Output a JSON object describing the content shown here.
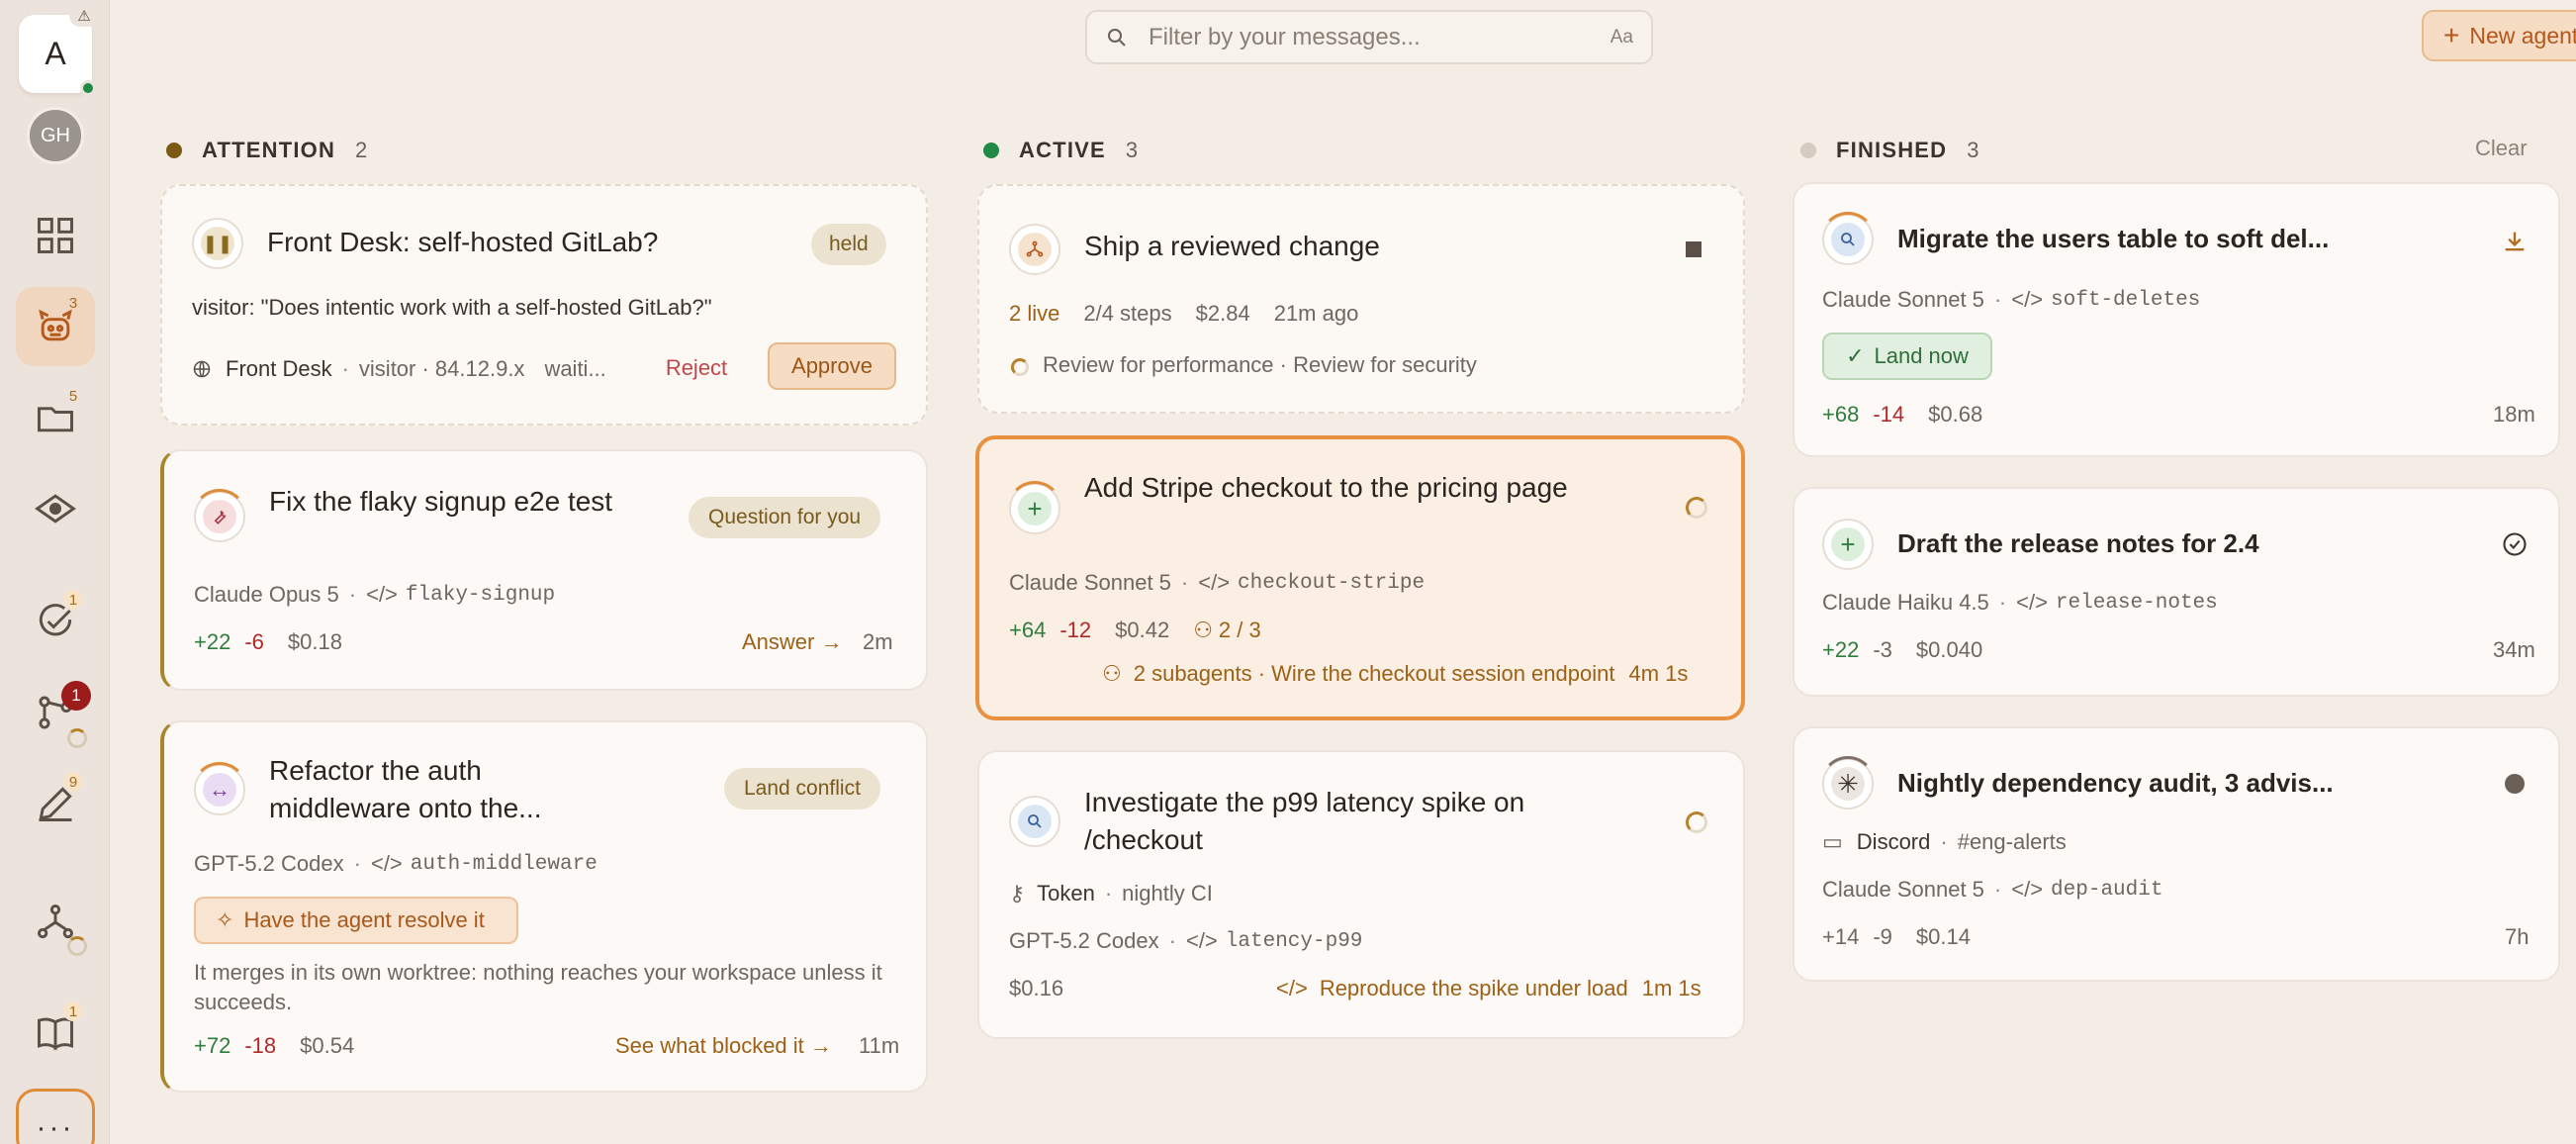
{
  "sidebar": {
    "logo_letter": "A",
    "warning_glyph": "⚠",
    "avatar_initials": "GH",
    "badges": {
      "agents": "3",
      "folder": "5",
      "tasks": "1",
      "git": "1",
      "edit": "9",
      "docs": "1"
    },
    "more_label": "···"
  },
  "search": {
    "placeholder": "Filter by your messages...",
    "case_toggle": "Aa"
  },
  "new_agent": {
    "plus": "+",
    "label": "New agent"
  },
  "columns": {
    "attention": {
      "title": "ATTENTION",
      "count": "2",
      "dot_color": "#7b5a14"
    },
    "active": {
      "title": "ACTIVE",
      "count": "3",
      "dot_color": "#1f8a45"
    },
    "finished": {
      "title": "FINISHED",
      "count": "3",
      "dot_color": "#d6cbc0",
      "clear": "Clear"
    }
  },
  "cards": {
    "front_desk": {
      "title": "Front Desk: self-hosted GitLab?",
      "badge": "held",
      "quote": "visitor: \"Does intentic work with a self-hosted GitLab?\"",
      "source": "Front Desk",
      "visitor": "visitor · 84.12.9.x",
      "waiting": "waiti...",
      "reject": "Reject",
      "approve": "Approve"
    },
    "flaky": {
      "title": "Fix the flaky signup e2e test",
      "badge": "Question for you",
      "model": "Claude Opus 5",
      "branch": "flaky-signup",
      "add": "+22",
      "del": "-6",
      "cost": "$0.18",
      "action": "Answer →",
      "time": "2m"
    },
    "refactor": {
      "title": "Refactor the auth middleware onto the...",
      "badge": "Land conflict",
      "model": "GPT-5.2 Codex",
      "branch": "auth-middleware",
      "resolve": "Have the agent resolve it",
      "note": "It merges in its own worktree: nothing reaches your workspace unless it succeeds.",
      "add": "+72",
      "del": "-18",
      "cost": "$0.54",
      "action": "See what blocked it →",
      "time": "11m"
    },
    "ship": {
      "title": "Ship a reviewed change",
      "live": "2 live",
      "steps": "2/4 steps",
      "cost": "$2.84",
      "ago": "21m ago",
      "reviews": "Review for performance · Review for security"
    },
    "stripe": {
      "title": "Add Stripe checkout to the pricing page",
      "model": "Claude Sonnet 5",
      "branch": "checkout-stripe",
      "add": "+64",
      "del": "-12",
      "cost": "$0.42",
      "agents": "2 / 3",
      "subagents": "2 subagents · Wire the checkout session endpoint",
      "time": "4m 1s"
    },
    "latency": {
      "title": "Investigate the p99 latency spike on /checkout",
      "token": "Token",
      "trigger": "nightly CI",
      "model": "GPT-5.2 Codex",
      "branch": "latency-p99",
      "cost": "$0.16",
      "step": "Reproduce the spike under load",
      "time": "1m 1s"
    },
    "migrate": {
      "title": "Migrate the users table to soft del...",
      "model": "Claude Sonnet 5",
      "branch": "soft-deletes",
      "land": "Land now",
      "add": "+68",
      "del": "-14",
      "cost": "$0.68",
      "time": "18m"
    },
    "release": {
      "title": "Draft the release notes for 2.4",
      "model": "Claude Haiku 4.5",
      "branch": "release-notes",
      "add": "+22",
      "del": "-3",
      "cost": "$0.040",
      "time": "34m"
    },
    "audit": {
      "title": "Nightly dependency audit, 3 advis...",
      "source": "Discord",
      "channel": "#eng-alerts",
      "model": "Claude Sonnet 5",
      "branch": "dep-audit",
      "add": "+14",
      "del": "-9",
      "cost": "$0.14",
      "time": "7h"
    }
  }
}
